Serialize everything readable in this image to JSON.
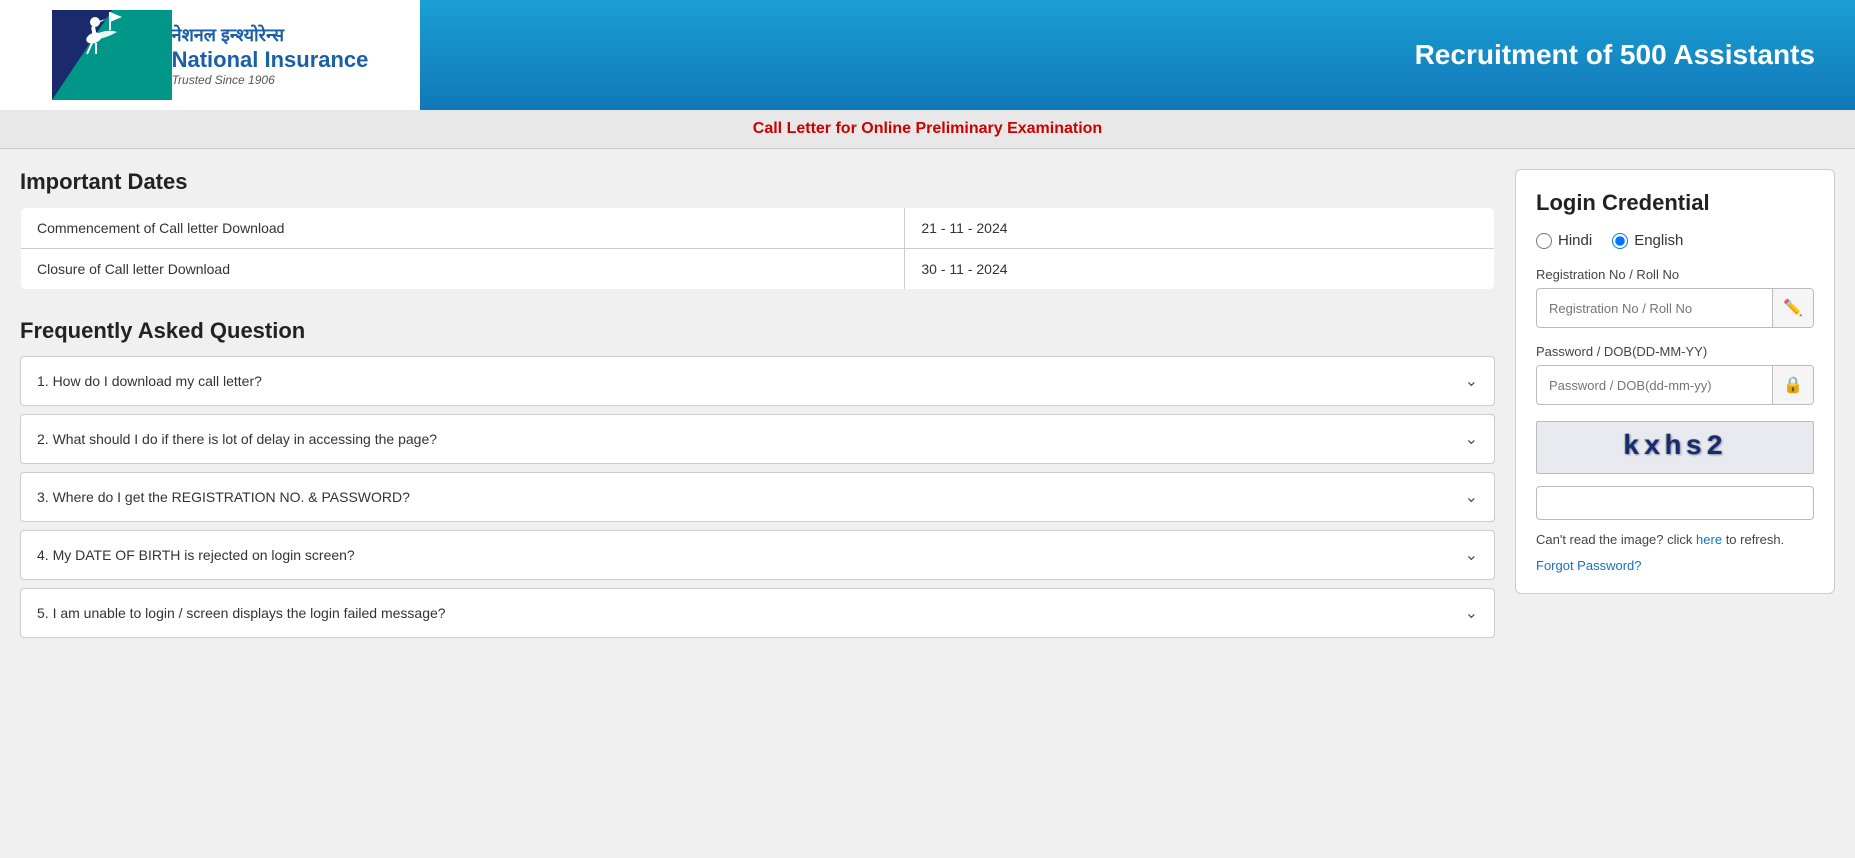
{
  "header": {
    "title": "Recruitment of 500 Assistants",
    "logo": {
      "hindi_text": "नेशनल इन्श्योरेन्स",
      "english_text": "National Insurance",
      "tagline": "Trusted Since 1906"
    }
  },
  "sub_header": {
    "text": "Call Letter for Online Preliminary Examination"
  },
  "important_dates": {
    "section_title": "Important Dates",
    "rows": [
      {
        "label": "Commencement of Call letter Download",
        "value": "21 - 11 - 2024"
      },
      {
        "label": "Closure of Call letter Download",
        "value": "30 - 11 - 2024"
      }
    ]
  },
  "faq": {
    "section_title": "Frequently Asked Question",
    "items": [
      {
        "id": 1,
        "question": "1. How do I download my call letter?"
      },
      {
        "id": 2,
        "question": "2. What should I do if there is lot of delay in accessing the page?"
      },
      {
        "id": 3,
        "question": "3. Where do I get the REGISTRATION NO. & PASSWORD?"
      },
      {
        "id": 4,
        "question": "4. My DATE OF BIRTH is rejected on login screen?"
      },
      {
        "id": 5,
        "question": "5. I am unable to login / screen displays the login failed message?"
      }
    ]
  },
  "login": {
    "title": "Login Credential",
    "language_options": {
      "hindi": "Hindi",
      "english": "English"
    },
    "registration_label": "Registration No / Roll No",
    "registration_placeholder": "Registration No / Roll No",
    "password_label": "Password / DOB(DD-MM-YY)",
    "password_placeholder": "Password / DOB(dd-mm-yy)",
    "captcha_text": "kxhs2",
    "captcha_refresh_text": "Can't read the image? click",
    "captcha_refresh_link": "here",
    "captcha_refresh_suffix": "to refresh.",
    "forgot_password": "Forgot Password?"
  }
}
